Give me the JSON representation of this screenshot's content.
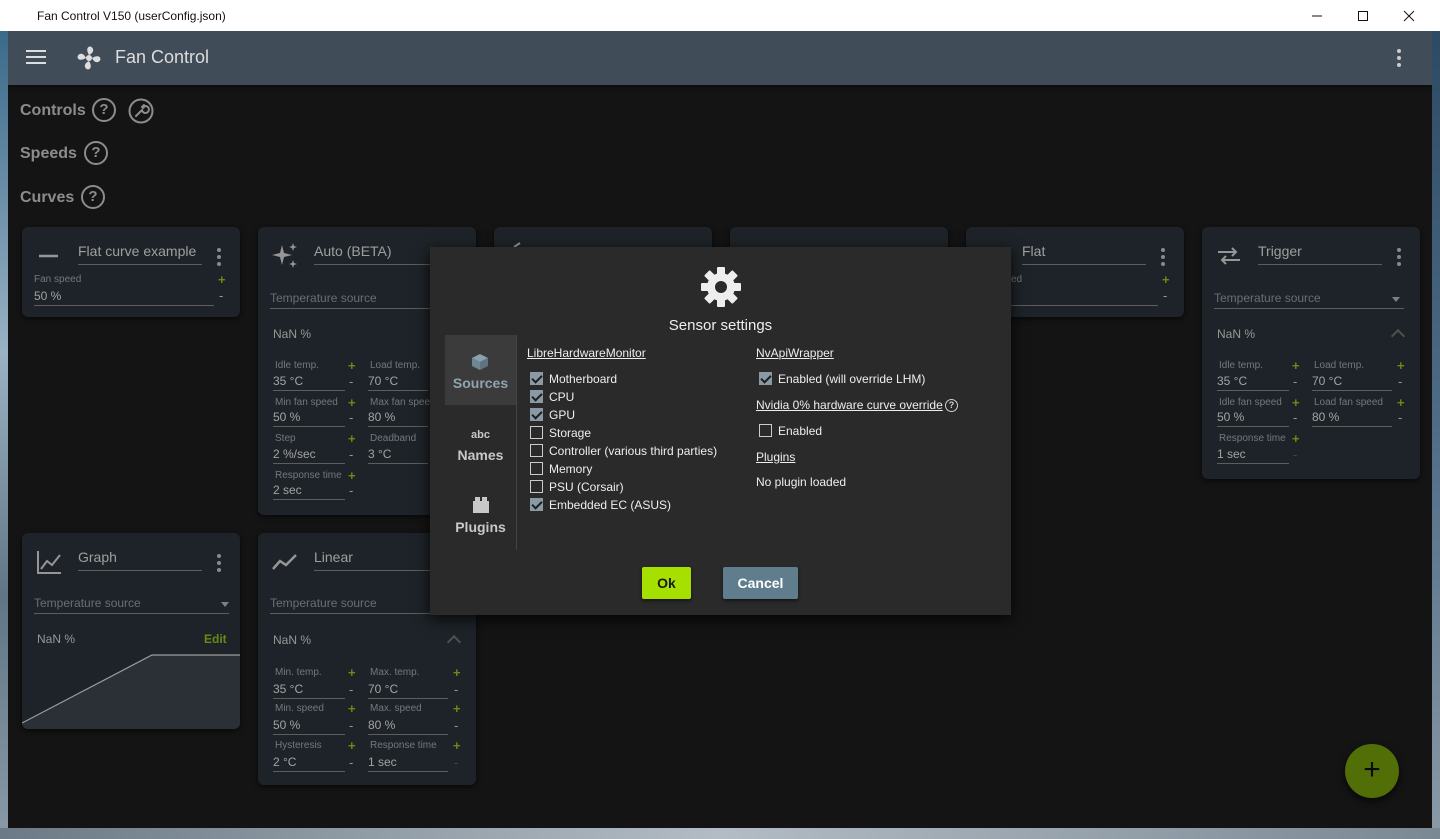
{
  "window": {
    "title": "Fan Control V150 (userConfig.json)"
  },
  "app": {
    "title": "Fan Control"
  },
  "sections": {
    "controls": "Controls",
    "speeds": "Speeds",
    "curves": "Curves",
    "help_glyph": "?"
  },
  "cards": {
    "flat_example": {
      "name": "Flat curve example",
      "fan_speed_label": "Fan speed",
      "fan_speed": "50 %"
    },
    "auto": {
      "name": "Auto (BETA)",
      "temp_source": "Temperature source",
      "nan": "NaN %",
      "idle_temp_label": "Idle temp.",
      "idle_temp": "35 °C",
      "load_temp_label": "Load temp.",
      "load_temp": "70 °C",
      "min_fan_label": "Min fan speed",
      "min_fan": "50 %",
      "max_fan_label": "Max fan spee",
      "max_fan": "80 %",
      "step_label": "Step",
      "step": "2 %/sec",
      "deadband_label": "Deadband",
      "deadband": "3 °C",
      "response_label": "Response time",
      "response": "2 sec"
    },
    "flat": {
      "name": "Flat",
      "fan_speed_label": "ed"
    },
    "trigger": {
      "name": "Trigger",
      "temp_source": "Temperature source",
      "nan": "NaN %",
      "idle_temp_label": "Idle temp.",
      "idle_temp": "35 °C",
      "load_temp_label": "Load temp.",
      "load_temp": "70 °C",
      "idle_fan_label": "Idle fan speed",
      "idle_fan": "50 %",
      "load_fan_label": "Load fan speed",
      "load_fan": "80 %",
      "response_label": "Response time",
      "response": "1 sec"
    },
    "graph": {
      "name": "Graph",
      "temp_source": "Temperature source",
      "nan": "NaN %",
      "edit": "Edit"
    },
    "linear": {
      "name": "Linear",
      "temp_source": "Temperature source",
      "nan": "NaN %",
      "min_temp_label": "Min. temp.",
      "min_temp": "35 °C",
      "max_temp_label": "Max. temp.",
      "max_temp": "70 °C",
      "min_speed_label": "Min. speed",
      "min_speed": "50 %",
      "max_speed_label": "Max. speed",
      "max_speed": "80 %",
      "hyst_label": "Hysteresis",
      "hyst": "2 °C",
      "response_label": "Response time",
      "response": "1 sec"
    }
  },
  "dialog": {
    "title": "Sensor settings",
    "tabs": {
      "sources": "Sources",
      "names": "Names",
      "names_glyph": "abc",
      "plugins": "Plugins"
    },
    "lhm": {
      "header": "LibreHardwareMonitor",
      "motherboard": "Motherboard",
      "cpu": "CPU",
      "gpu": "GPU",
      "storage": "Storage",
      "controller": "Controller (various third parties)",
      "memory": "Memory",
      "psu": "PSU (Corsair)",
      "ec": "Embedded EC (ASUS)"
    },
    "nvapi": {
      "header": "NvApiWrapper",
      "enabled": "Enabled (will override LHM)",
      "override_header": "Nvidia 0% hardware curve override",
      "override_enabled": "Enabled"
    },
    "plugins": {
      "header": "Plugins",
      "status": "No plugin loaded"
    },
    "ok": "Ok",
    "cancel": "Cancel"
  },
  "signs": {
    "plus": "+",
    "minus": "-"
  },
  "colors": {
    "accent": "#9ccc1e",
    "ok_button": "#a6e000",
    "cancel_button": "#5f7d8c",
    "appbar": "#404c57",
    "card": "#2b343b"
  }
}
